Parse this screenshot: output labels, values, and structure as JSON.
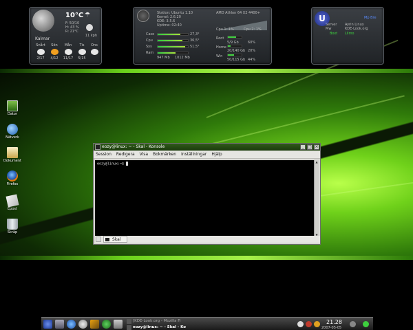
{
  "weather": {
    "temp": "10°C",
    "line1": "F: 50/10",
    "line2": "H: 43 %",
    "line3": "R: 21°C",
    "city": "Kalmar",
    "wind": "11 kph",
    "days": [
      {
        "name": "Snårt",
        "temps": "2/17"
      },
      {
        "name": "Sön",
        "temps": "4/12"
      },
      {
        "name": "Mån",
        "temps": "11/17"
      },
      {
        "name": "Tis",
        "temps": "5/15"
      },
      {
        "name": "Ons",
        "temps": ""
      }
    ]
  },
  "sysinfo": {
    "title": "Station: Ubuntu 1.10",
    "kernel": "Kernel: 2.6.20",
    "kde": "KDE: 3.5.6",
    "uptime": "Uptime: 02:40",
    "cpu_name": "AMD Athlon 64 X2 4400+",
    "cpu1": "Cpu 1: 1%",
    "cpu2": "Cpu 2: 1%",
    "rows": [
      {
        "label": "Case",
        "value": "27,3°",
        "fill": 0.75
      },
      {
        "label": "Cpu",
        "value": "36,5°",
        "fill": 0.82
      },
      {
        "label": "Sys",
        "value": "51,5°",
        "fill": 0.9
      },
      {
        "label": "Ram",
        "value": "",
        "fill": 0.6
      }
    ],
    "ram_used": "947 Mb",
    "ram_total": "1012 Mb",
    "disks": [
      {
        "label": "Root",
        "value": "5/9 Gb",
        "pct": "60%",
        "fill": 0.6
      },
      {
        "label": "Home",
        "value": "20/140 Gb",
        "pct": "20%",
        "fill": 0.2
      },
      {
        "label": "Win",
        "value": "50/115 Gb",
        "pct": "44%",
        "fill": 0.44
      }
    ]
  },
  "userinfo": {
    "logo": "U",
    "links": "Mp   Bre",
    "server_label": "Server",
    "server_value": "Ayrin Linux",
    "user_label": "Mw",
    "user_value": "KDE-Look.org",
    "status_label": "Boxt",
    "status_value": "Lllmo"
  },
  "desktop_icons": [
    {
      "label": "Dator"
    },
    {
      "label": "Nätverk"
    },
    {
      "label": "Dokument"
    },
    {
      "label": "Firefox"
    },
    {
      "label": "Epost"
    },
    {
      "label": "Skräp"
    }
  ],
  "konsole": {
    "title": "eozy@linux: ~ - Skal - Konsole",
    "menu": [
      "Session",
      "Redigera",
      "Visa",
      "Bokmärken",
      "Inställningar",
      "Hjälp"
    ],
    "prompt": "eozy@linux:~$ ",
    "tab_label": "Skal"
  },
  "taskbar": {
    "tasks": [
      {
        "label": "[KDE-Look.org - Mozilla Fi"
      },
      {
        "label": "eozy@linux: ~ - Skal - Ko"
      }
    ],
    "clock_time": "21.28",
    "clock_date": "2007-05-05"
  },
  "colors": {
    "accent": "#6ad11b",
    "window_title": "#2f5a1a"
  }
}
